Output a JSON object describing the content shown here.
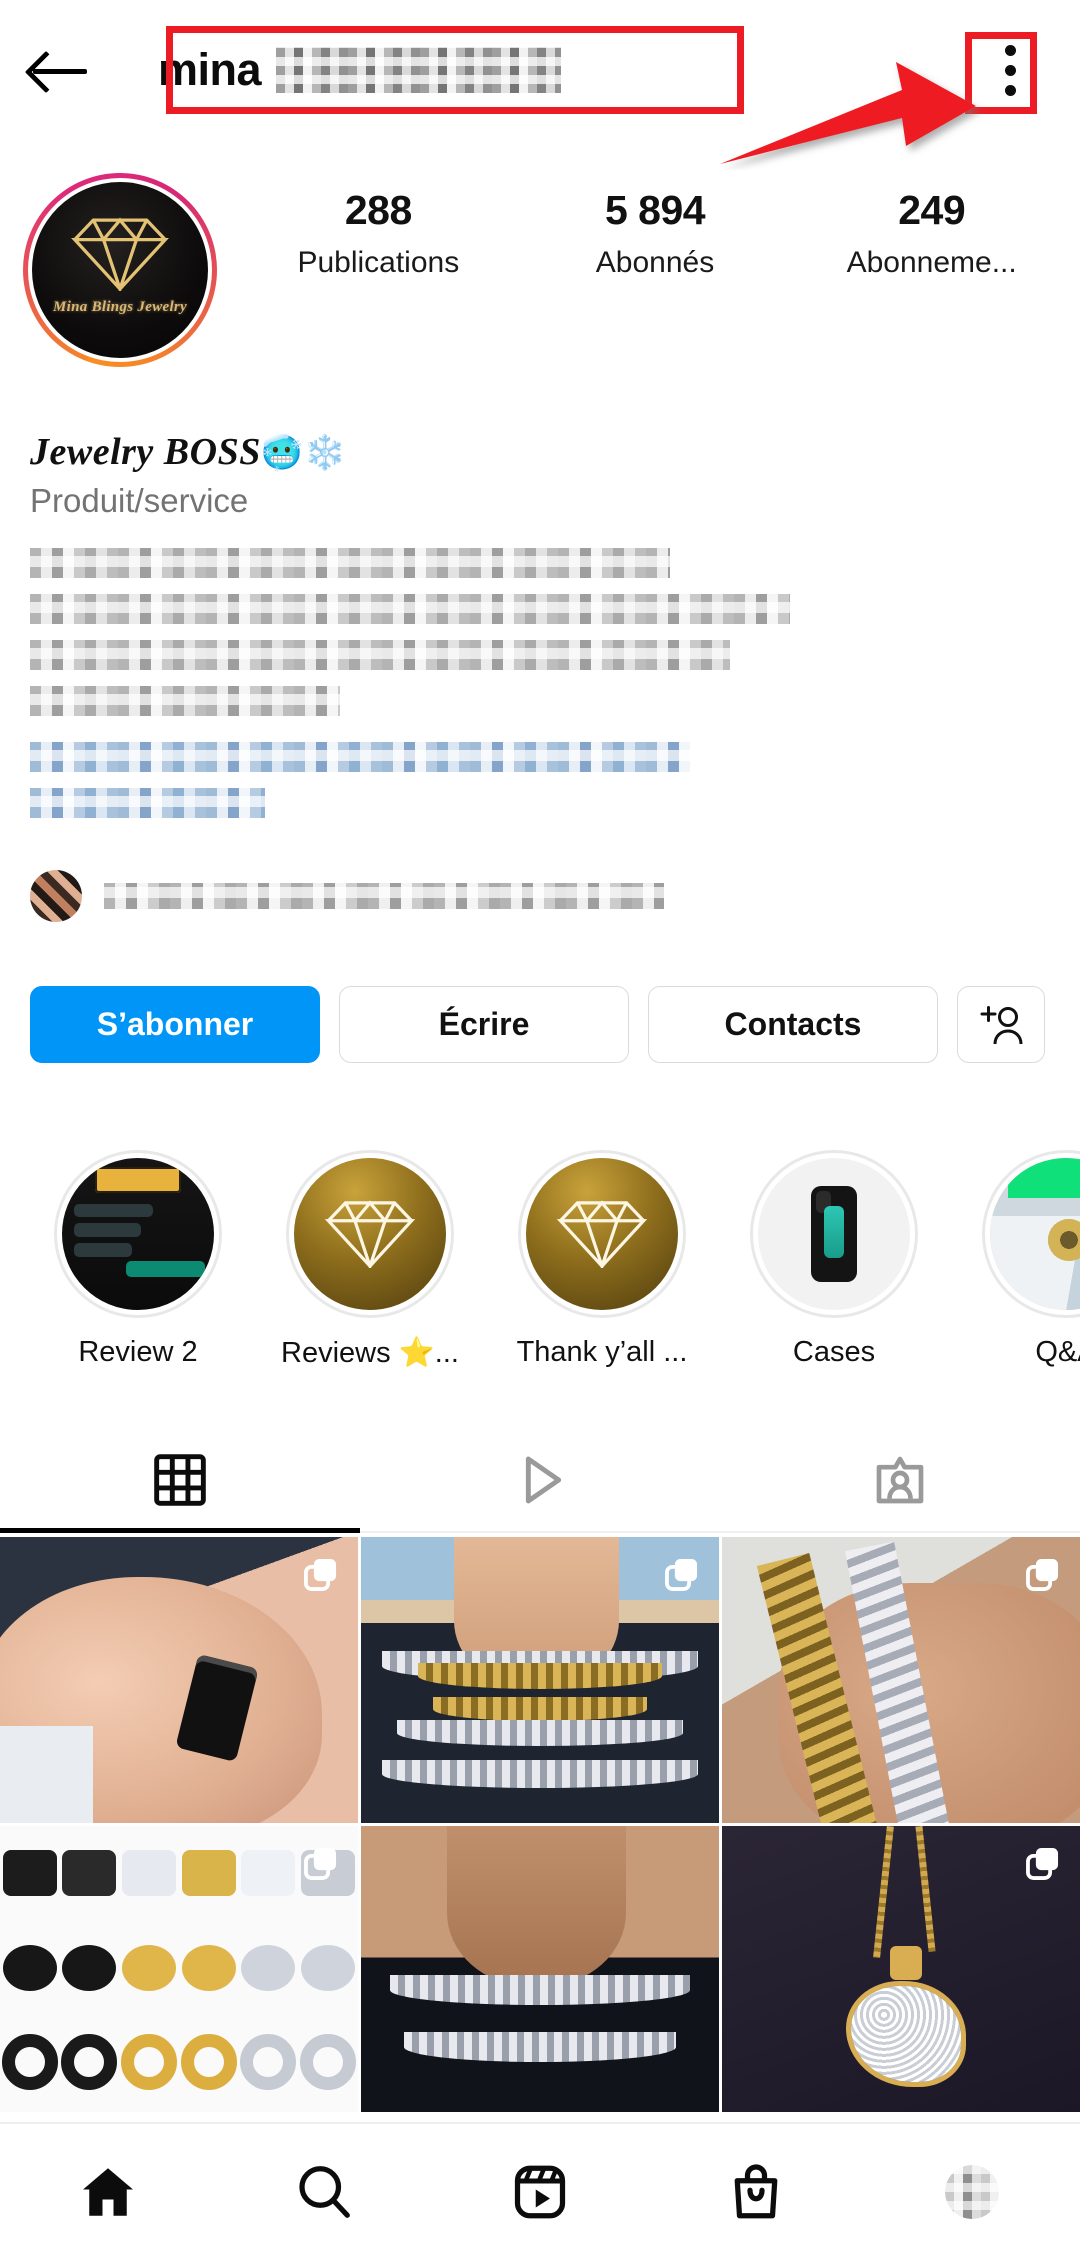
{
  "header": {
    "back_icon": "back-arrow-icon",
    "username": "mina_blings_jewelry",
    "username_visible_prefix": "mina",
    "menu_icon": "three-dot-menu-icon"
  },
  "annotations": {
    "color": "#ed1c24",
    "username_box": "red-highlight-box-username",
    "menu_box": "red-highlight-box-menu",
    "arrow": "red-arrow-pointing-to-menu"
  },
  "profile": {
    "avatar_alt": "Mina Blings Jewelry gold diamond logo",
    "avatar_caption": "Mina Blings Jewelry",
    "has_story_ring": true,
    "stats": [
      {
        "value": "288",
        "label": "Publications"
      },
      {
        "value": "5 894",
        "label": "Abonnés"
      },
      {
        "value": "249",
        "label": "Abonneme..."
      }
    ],
    "display_name": "Jewelry BOSS",
    "display_name_emoji": "🥶❄️",
    "category": "Produit/service",
    "bio_lines_censored": 3,
    "translate_link_censored": true,
    "external_link_censored": true,
    "location_censored": true,
    "mutual_followers_censored": true
  },
  "actions": [
    {
      "label": "S’abonner",
      "style": "primary",
      "name": "follow-button"
    },
    {
      "label": "Écrire",
      "style": "secondary",
      "name": "message-button"
    },
    {
      "label": "Contacts",
      "style": "secondary",
      "name": "contacts-button"
    },
    {
      "label": "",
      "style": "icon",
      "name": "suggest-users-button",
      "icon": "person-add-icon"
    }
  ],
  "highlights": [
    {
      "label": "Review 2",
      "art": "chat-screenshot"
    },
    {
      "label": "Reviews ⭐...",
      "art": "gold-diamond"
    },
    {
      "label": "Thank y’all ...",
      "art": "gold-diamond"
    },
    {
      "label": "Cases",
      "art": "phone-case"
    },
    {
      "label": "Q&A",
      "art": "gold-ring-photo"
    }
  ],
  "tabs": [
    {
      "name": "grid-tab",
      "icon": "grid-icon",
      "active": true
    },
    {
      "name": "reels-tab",
      "icon": "play-triangle-icon",
      "active": false
    },
    {
      "name": "tagged-tab",
      "icon": "tagged-person-icon",
      "active": false
    }
  ],
  "posts": [
    {
      "alt": "black ring worn on hand",
      "carousel": true
    },
    {
      "alt": "gold and silver cuban link chains on neck",
      "carousel": true
    },
    {
      "alt": "gold and diamond cuban bracelets on wrist",
      "carousel": true
    },
    {
      "alt": "assorted stud and hoop earrings set",
      "carousel": true
    },
    {
      "alt": "silver iced cuban chains on neck",
      "carousel": false
    },
    {
      "alt": "gold Africa pendant with rope chains",
      "carousel": true
    }
  ],
  "bottom_nav": [
    {
      "name": "home-nav",
      "icon": "home-icon",
      "active": true
    },
    {
      "name": "search-nav",
      "icon": "search-icon",
      "active": false
    },
    {
      "name": "reels-nav",
      "icon": "reels-icon",
      "active": false
    },
    {
      "name": "shop-nav",
      "icon": "shopping-bag-icon",
      "active": false
    },
    {
      "name": "profile-nav",
      "icon": "profile-avatar-icon",
      "active": false
    }
  ]
}
